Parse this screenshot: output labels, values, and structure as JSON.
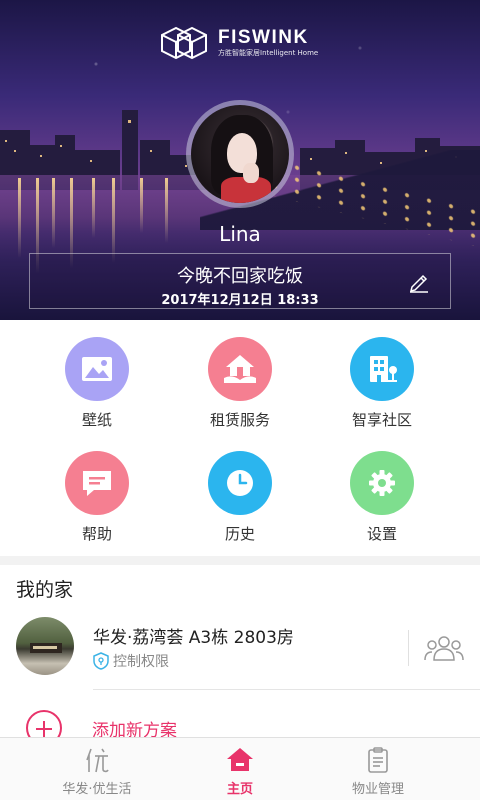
{
  "header": {
    "logo": {
      "title": "FISWINK",
      "subtitle": "方胜智能家居Intelligent Home",
      "icon": "cube-logo-icon"
    },
    "user": {
      "name": "Lina"
    },
    "message": {
      "text": "今晚不回家吃饭",
      "time": "2017年12月12日 18:33",
      "edit_icon": "pencil-icon"
    }
  },
  "grid": {
    "items": [
      {
        "label": "壁纸",
        "icon": "image-icon",
        "color": "#a9a3f5"
      },
      {
        "label": "租赁服务",
        "icon": "house-hand-icon",
        "color": "#f57f91"
      },
      {
        "label": "智享社区",
        "icon": "building-icon",
        "color": "#2bb5ee"
      },
      {
        "label": "帮助",
        "icon": "chat-bubble-icon",
        "color": "#f57f91"
      },
      {
        "label": "历史",
        "icon": "clock-icon",
        "color": "#2bb5ee"
      },
      {
        "label": "设置",
        "icon": "gear-icon",
        "color": "#7ede8e"
      }
    ]
  },
  "my_home": {
    "title": "我的家",
    "house_name": "华发·荔湾荟 A3栋 2803房",
    "permission": "控制权限",
    "add_label": "添加新方案"
  },
  "bottom_nav": {
    "items": [
      {
        "label": "华发·优生活",
        "icon": "you-life-icon",
        "active": false
      },
      {
        "label": "主页",
        "icon": "home-icon",
        "active": true
      },
      {
        "label": "物业管理",
        "icon": "clipboard-icon",
        "active": false
      }
    ]
  },
  "colors": {
    "accent": "#e8336a"
  }
}
